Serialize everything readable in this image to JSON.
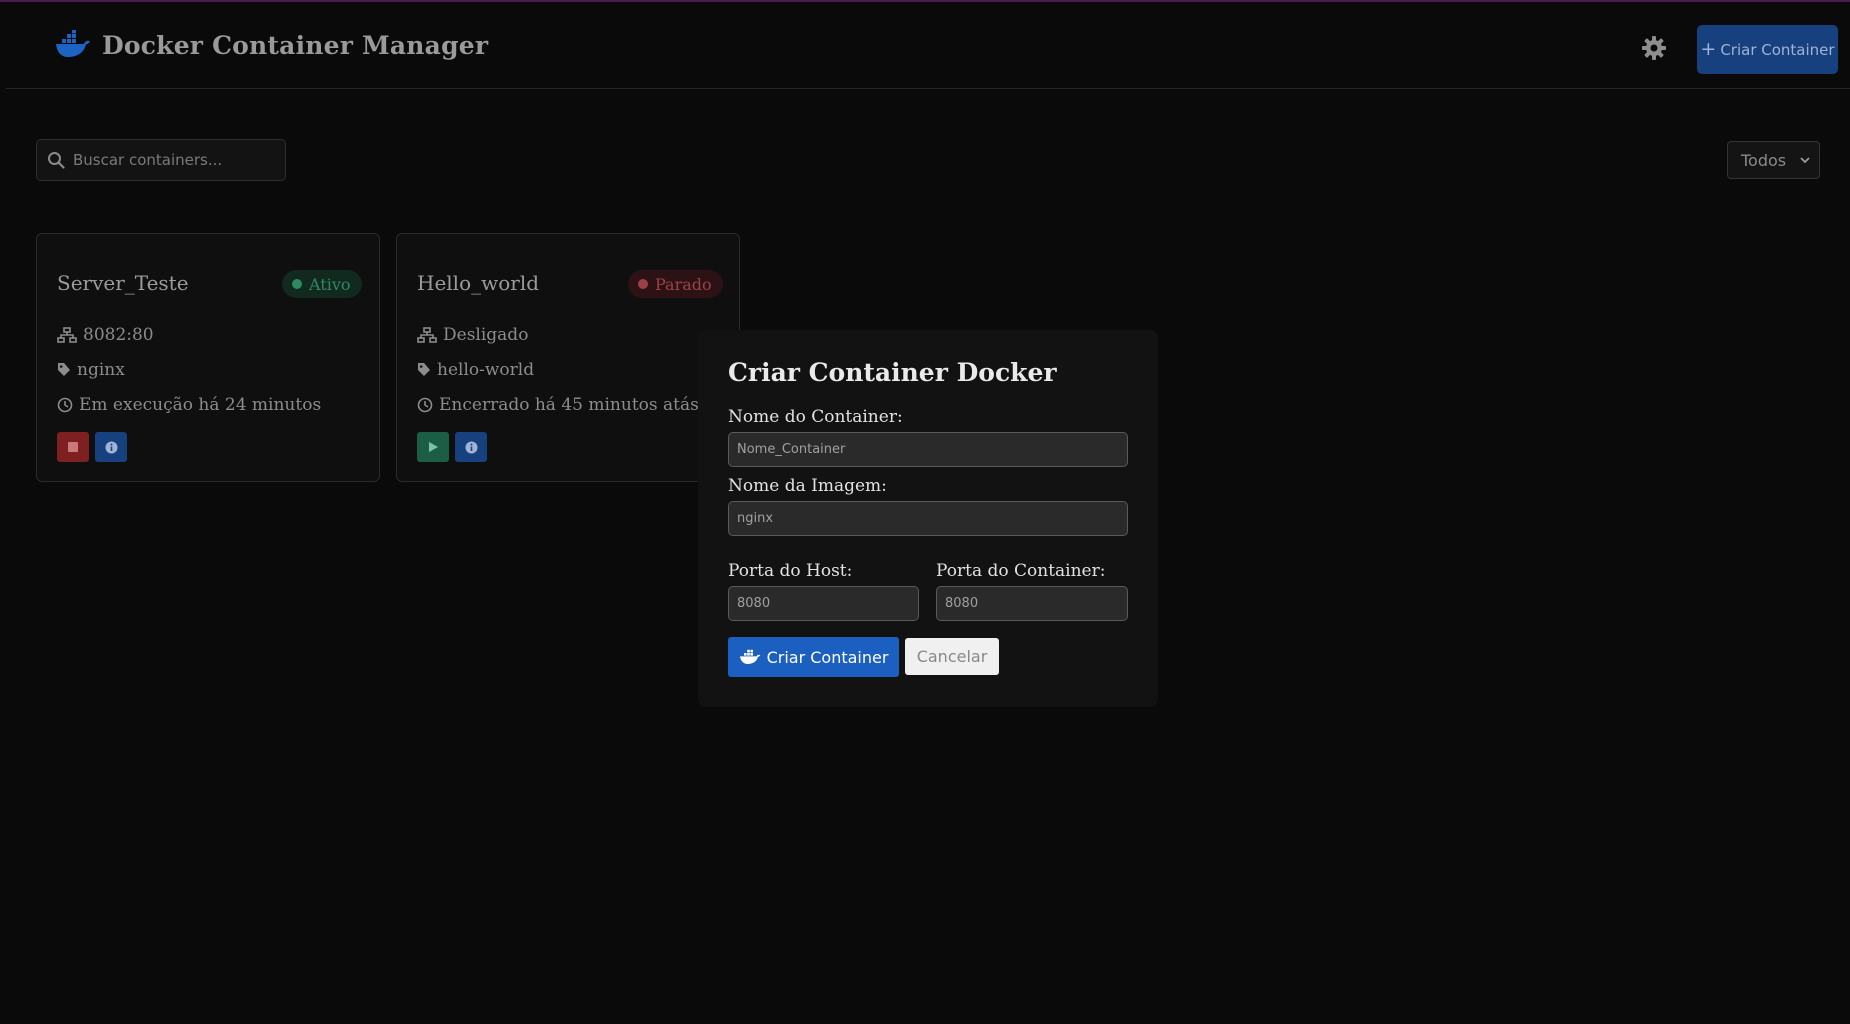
{
  "app": {
    "title": "Docker Container Manager",
    "create_label": "Criar Container",
    "create_plus": "+"
  },
  "toolbar": {
    "search_placeholder": "Buscar containers...",
    "filter_value": "Todos"
  },
  "containers": [
    {
      "name": "Server_Teste",
      "status": "Ativo",
      "port": "8082:80",
      "image": "nginx",
      "uptime": "Em execução há 24 minutos"
    },
    {
      "name": "Hello_world",
      "status": "Parado",
      "port": "Desligado",
      "image": "hello-world",
      "uptime": "Encerrado há 45 minutos atás"
    }
  ],
  "modal": {
    "title": "Criar Container Docker",
    "name_label": "Nome do Container:",
    "name_placeholder": "Nome_Container",
    "image_label": "Nome da Imagem:",
    "image_placeholder": "nginx",
    "host_port_label": "Porta do Host:",
    "host_port_placeholder": "8080",
    "container_port_label": "Porta do Container:",
    "container_port_placeholder": "8080",
    "submit_label": "Criar Container",
    "cancel_label": "Cancelar"
  },
  "colors": {
    "background": "#0a0a0a",
    "accent_blue": "#1b5fc0",
    "status_active": "#2f8a64",
    "status_stopped": "#9b4248",
    "stop_button": "#7e1f22",
    "play_button": "#1c5e45"
  },
  "icons": {
    "brand": "docker-whale-icon",
    "theme": "gear-icon",
    "search": "search-icon",
    "port": "network-icon",
    "image": "tag-icon",
    "uptime": "clock-icon",
    "stop": "stop-icon",
    "start": "play-icon",
    "info": "info-icon"
  }
}
